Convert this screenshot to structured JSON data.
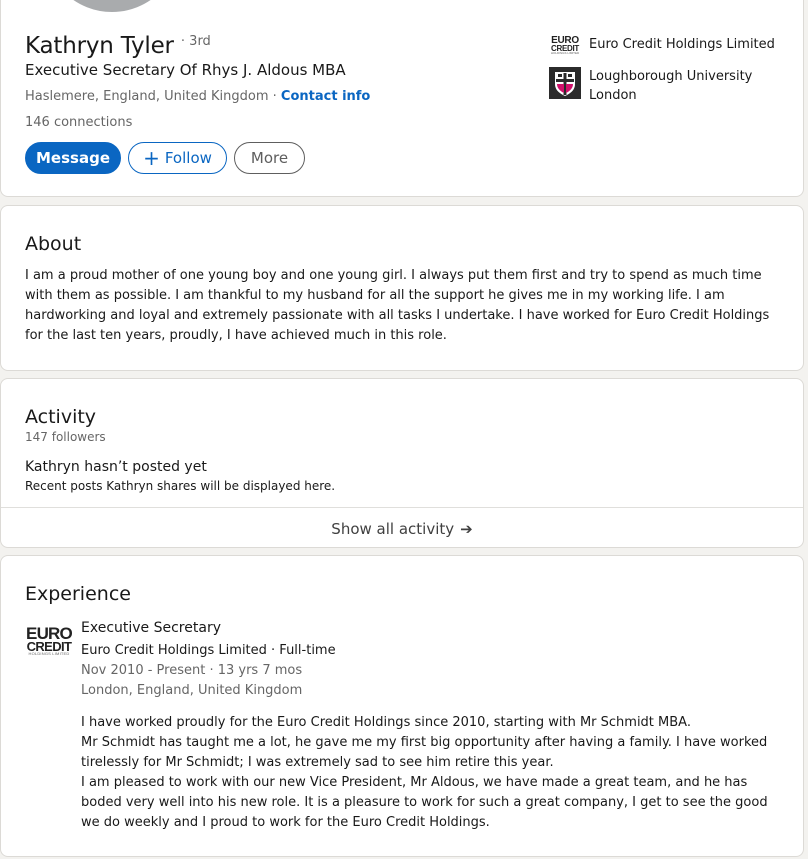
{
  "profile": {
    "name": "Kathryn Tyler",
    "degree": "· 3rd",
    "headline": "Executive Secretary Of Rhys J. Aldous MBA",
    "location": "Haslemere, England, United Kingdom",
    "location_separator": " · ",
    "contact_info": "Contact info",
    "connections": "146 connections",
    "buttons": {
      "message": "Message",
      "follow": "Follow",
      "more": "More"
    },
    "organizations": [
      {
        "name": "Euro Credit Holdings Limited",
        "icon": "euro-credit-logo"
      },
      {
        "name": "Loughborough University London",
        "icon": "loughborough-crest-logo"
      }
    ],
    "logo_text": {
      "line1": "EURO",
      "line2": "CREDIT",
      "line3": "HOLDINGS LIMITED"
    },
    "colors": {
      "primary": "#0a66c2",
      "lboro_magenta": "#d0116a"
    }
  },
  "about": {
    "title": "About",
    "text": "I am a proud mother of one young boy and one young girl. I always put them first and try to spend as much time with them as possible. I am thankful to my husband for all the support he gives me in my working life. I am hardworking and loyal and extremely passionate with all tasks I undertake. I have worked for Euro Credit Holdings for the last ten years, proudly, I have achieved much in this role."
  },
  "activity": {
    "title": "Activity",
    "followers": "147 followers",
    "empty_title": "Kathryn hasn’t posted yet",
    "empty_subtitle": "Recent posts Kathryn shares will be displayed here.",
    "show_all": "Show all activity"
  },
  "experience": {
    "title": "Experience",
    "items": [
      {
        "role": "Executive Secretary",
        "company": "Euro Credit Holdings Limited · Full-time",
        "dates": "Nov 2010 - Present · 13 yrs 7 mos",
        "location": "London, England, United Kingdom",
        "description": [
          "I have worked proudly for the Euro Credit Holdings since 2010, starting with Mr Schmidt MBA.",
          "Mr Schmidt has taught me a lot, he gave me my first big opportunity after having a family. I have worked tirelessly for Mr Schmidt; I was extremely sad to see him retire this year.",
          "I am pleased to work with our new Vice President, Mr Aldous, we have made a great team, and he has boded very well into his new role. It is a pleasure to work for such a great company, I get to see the good we do weekly and I proud to work for the Euro Credit Holdings."
        ]
      }
    ]
  }
}
